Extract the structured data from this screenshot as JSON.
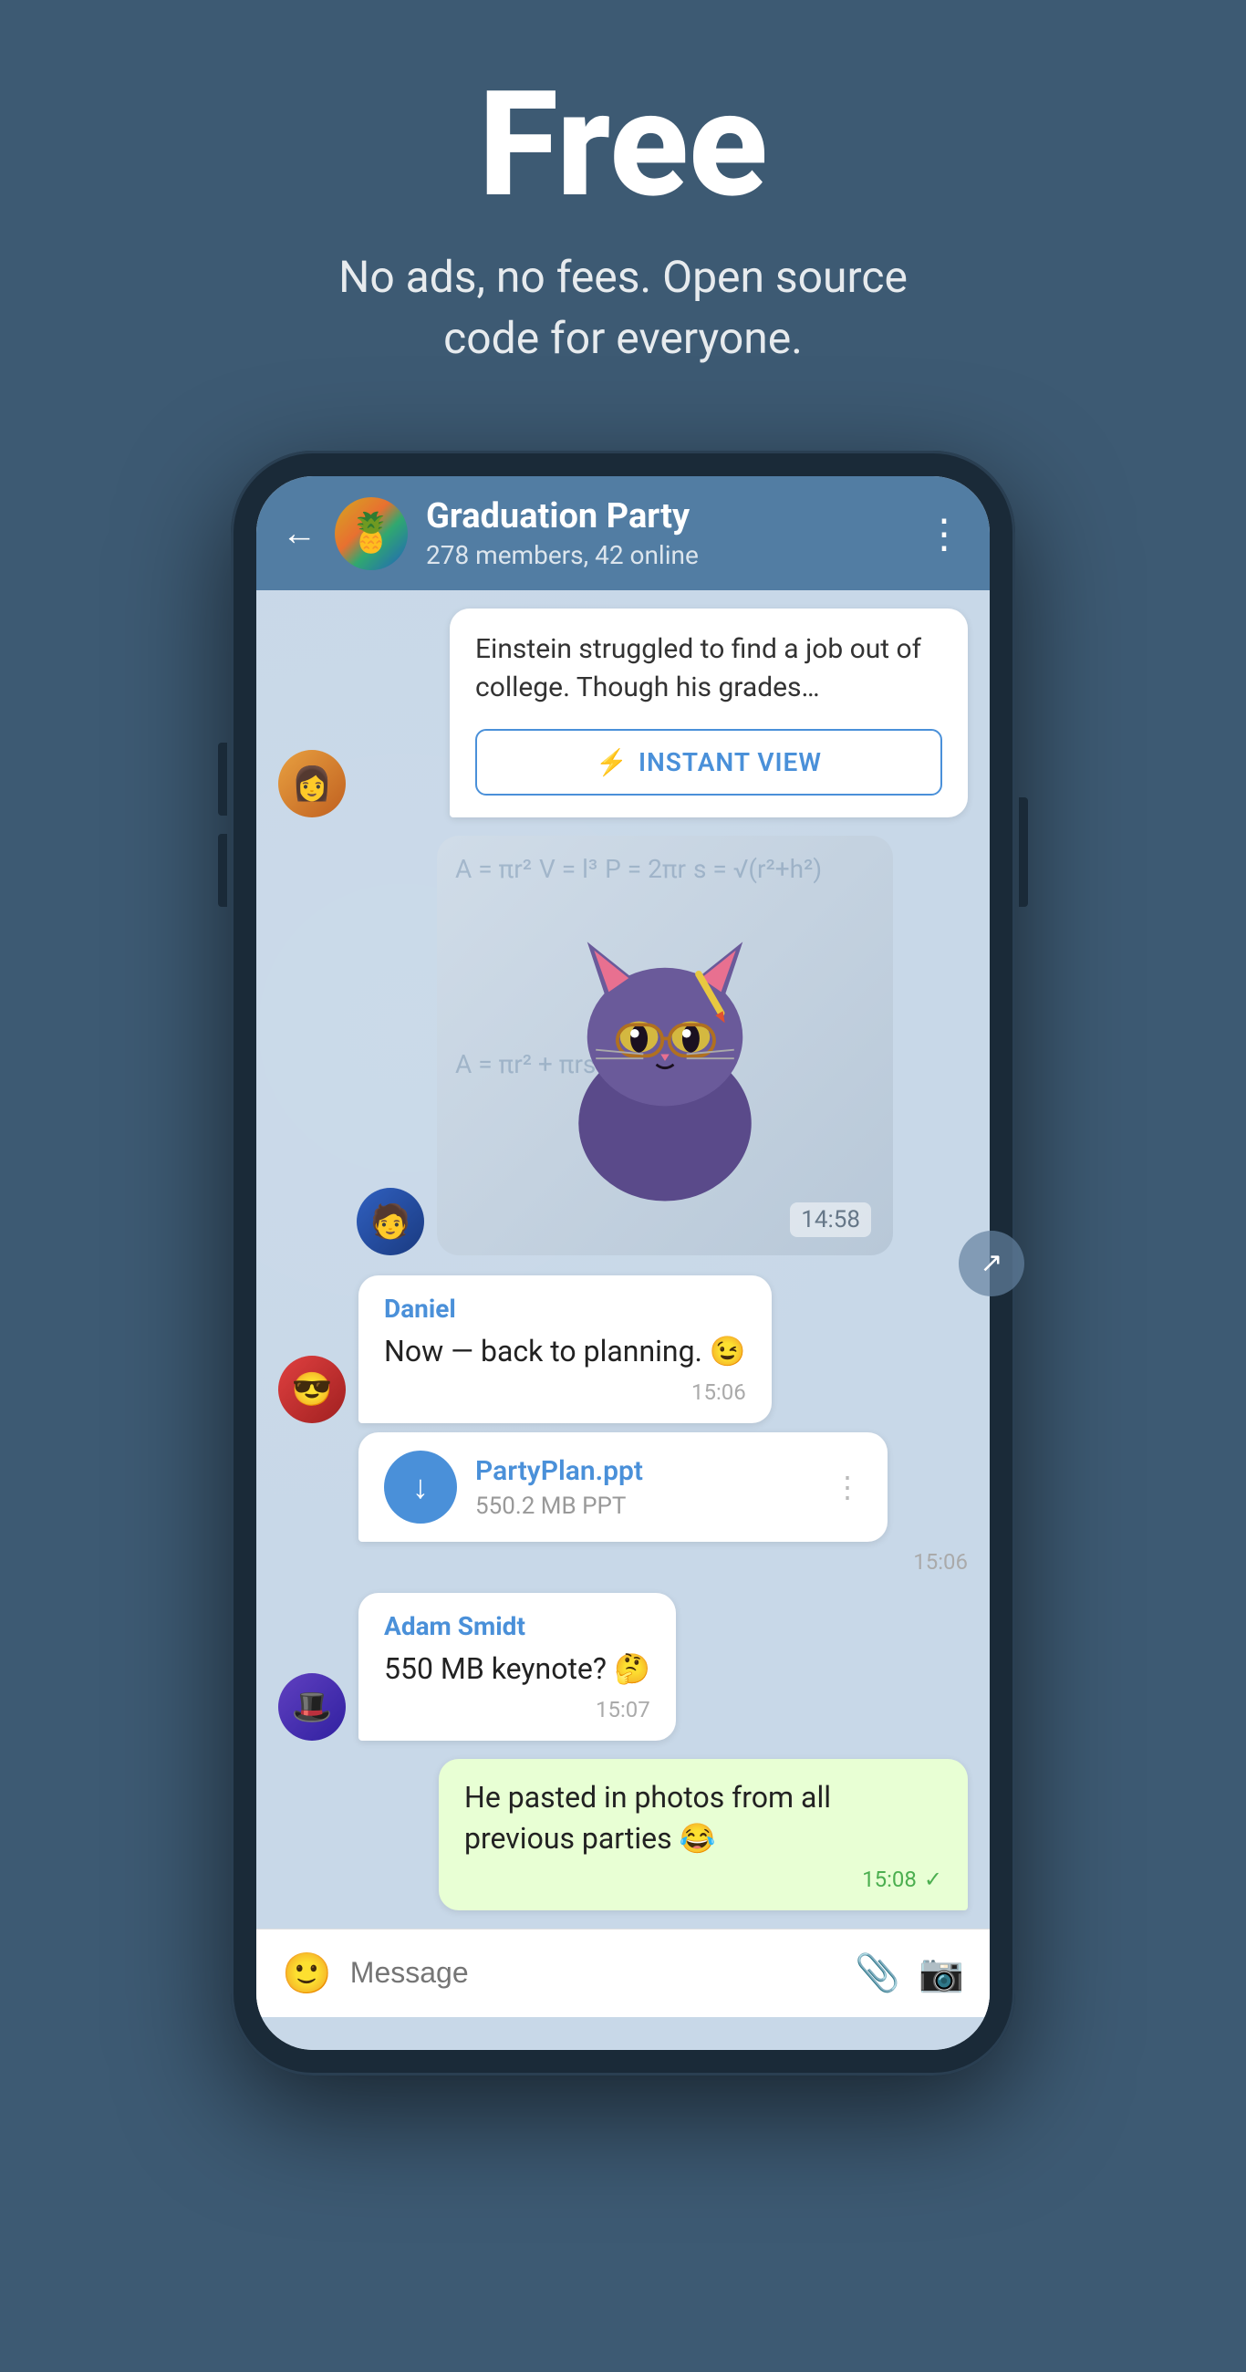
{
  "hero": {
    "title": "Free",
    "subtitle": "No ads, no fees. Open source\ncode for everyone."
  },
  "phone": {
    "header": {
      "back_label": "←",
      "chat_name": "Graduation Party",
      "chat_meta": "278 members, 42 online",
      "menu_icon": "⋮"
    },
    "messages": [
      {
        "id": "article-msg",
        "type": "article",
        "text": "Einstein struggled to find a job out of college. Though his grades...",
        "instant_view_label": "INSTANT VIEW"
      },
      {
        "id": "sticker-msg",
        "type": "sticker",
        "time": "14:58"
      },
      {
        "id": "daniel-msg",
        "type": "text",
        "sender": "Daniel",
        "text": "Now — back to planning. 😉",
        "time": "15:06"
      },
      {
        "id": "file-msg",
        "type": "file",
        "file_name": "PartyPlan.ppt",
        "file_size": "550.2 MB PPT",
        "time": "15:06"
      },
      {
        "id": "adam-msg",
        "type": "text",
        "sender": "Adam Smidt",
        "text": "550 MB keynote? 🤔",
        "time": "15:07"
      },
      {
        "id": "own-msg",
        "type": "own",
        "text": "He pasted in photos from all previous parties 😂",
        "time": "15:08",
        "checkmark": "✓"
      }
    ],
    "input": {
      "placeholder": "Message"
    }
  }
}
